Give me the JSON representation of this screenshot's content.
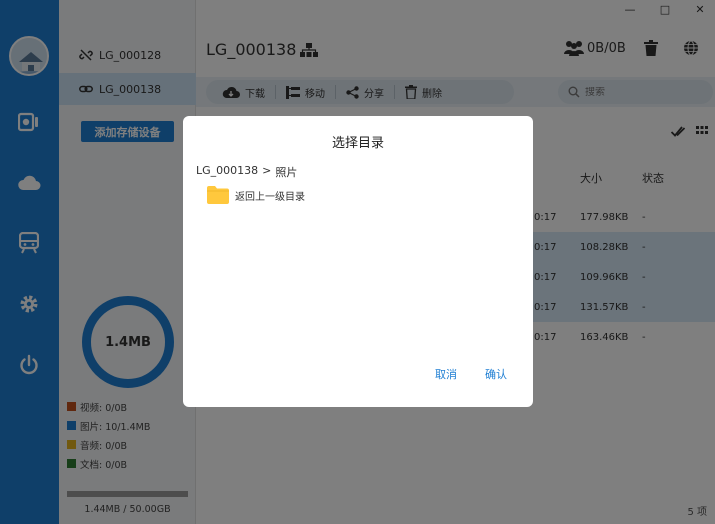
{
  "devices": [
    {
      "name": "LG_000128",
      "status": "disconnected"
    },
    {
      "name": "LG_000138",
      "status": "connected"
    }
  ],
  "add_device_label": "添加存储设备",
  "storage": {
    "used_label": "1.4MB",
    "legend": [
      {
        "label": "视频: 0/0B",
        "color": "#c0501e"
      },
      {
        "label": "图片: 10/1.4MB",
        "color": "#1e7ed3"
      },
      {
        "label": "音频: 0/0B",
        "color": "#e3b21e"
      },
      {
        "label": "文档: 0/0B",
        "color": "#2e7d32"
      }
    ],
    "capacity_text": "1.44MB / 50.00GB",
    "capacity_fraction": 3e-05
  },
  "header": {
    "device_title": "LG_000138",
    "transfer": "0B/0B"
  },
  "toolbar": {
    "download": "下载",
    "move": "移动",
    "share": "分享",
    "delete": "删除",
    "search_placeholder": "搜索"
  },
  "columns": {
    "size": "大小",
    "status": "状态"
  },
  "rows": [
    {
      "time": "0:17",
      "size": "177.98KB",
      "status": "-",
      "selected": false
    },
    {
      "time": "0:17",
      "size": "108.28KB",
      "status": "-",
      "selected": true
    },
    {
      "time": "0:17",
      "size": "109.96KB",
      "status": "-",
      "selected": true
    },
    {
      "time": "0:17",
      "size": "131.57KB",
      "status": "-",
      "selected": true
    },
    {
      "time": "0:17",
      "size": "163.46KB",
      "status": "-",
      "selected": false
    }
  ],
  "footer_count": "5 项",
  "dialog": {
    "title": "选择目录",
    "path_root": "LG_000138",
    "path_sep": ">",
    "path_current": "照片",
    "folder_item": "返回上一级目录",
    "cancel": "取消",
    "confirm": "确认"
  },
  "colors": {
    "accent": "#1e7ed3",
    "folder": "#ffc83d"
  }
}
